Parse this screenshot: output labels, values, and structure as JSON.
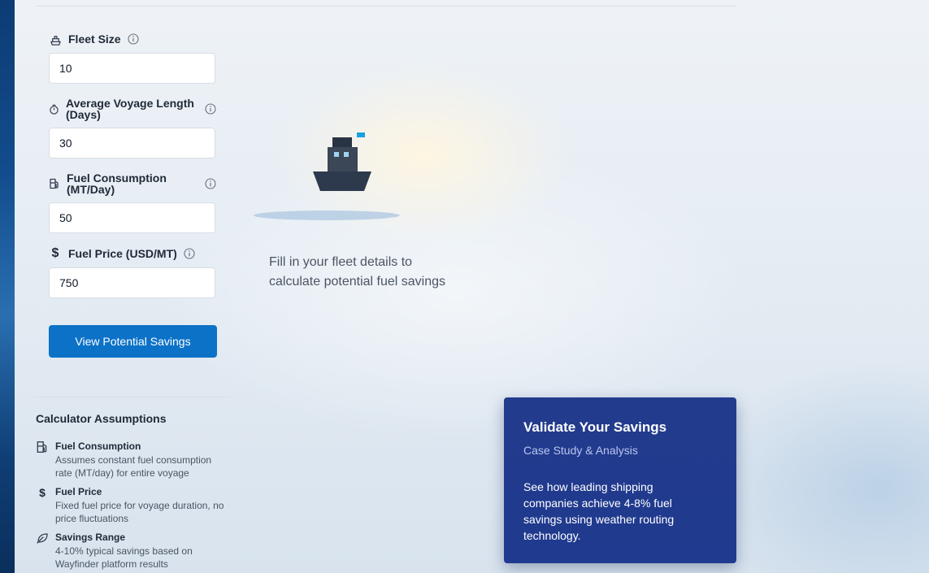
{
  "form": {
    "fleet_size": {
      "label": "Fleet Size",
      "value": "10",
      "icon": "ship-icon"
    },
    "voyage_length": {
      "label": "Average Voyage Length (Days)",
      "value": "30",
      "icon": "stopwatch-icon"
    },
    "fuel_consumption": {
      "label": "Fuel Consumption (MT/Day)",
      "value": "50",
      "icon": "fuel-pump-icon"
    },
    "fuel_price": {
      "label": "Fuel Price (USD/MT)",
      "value": "750",
      "icon": "dollar-icon"
    },
    "submit_label": "View Potential Savings"
  },
  "assumptions": {
    "title": "Calculator Assumptions",
    "items": [
      {
        "title": "Fuel Consumption",
        "desc": "Assumes constant fuel consumption rate (MT/day) for entire voyage",
        "icon": "fuel-pump-icon"
      },
      {
        "title": "Fuel Price",
        "desc": "Fixed fuel price for voyage duration, no price fluctuations",
        "icon": "dollar-icon"
      },
      {
        "title": "Savings Range",
        "desc": "4-10% typical savings based on Wayfinder platform results",
        "icon": "leaf-icon"
      }
    ]
  },
  "result": {
    "placeholder": "Fill in your fleet details to calculate potential fuel savings"
  },
  "card": {
    "title": "Validate Your Savings",
    "subtitle": "Case Study & Analysis",
    "body": "See how leading shipping companies achieve 4-8% fuel savings using weather routing technology."
  },
  "colors": {
    "primary_button": "#0c72c7",
    "card_bg": "#1f3a8f",
    "ship_flag": "#16a3e0"
  }
}
